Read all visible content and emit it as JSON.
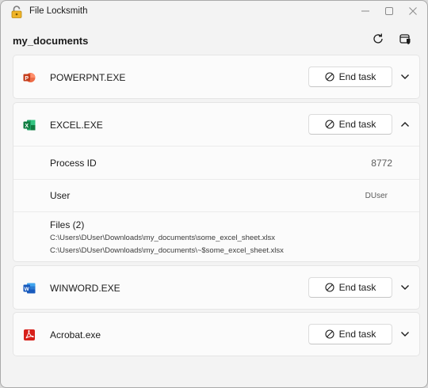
{
  "window": {
    "title": "File Locksmith",
    "controls": {
      "minimize": "minimize",
      "maximize": "maximize",
      "close": "close"
    }
  },
  "header": {
    "folder": "my_documents",
    "refresh_icon": "refresh-icon",
    "admin_icon": "run-as-admin-icon"
  },
  "processes": [
    {
      "name": "POWERPNT.EXE",
      "icon": "powerpoint-icon",
      "end_task_label": "End task",
      "expanded": false,
      "icon_color": "#c43e1c"
    },
    {
      "name": "EXCEL.EXE",
      "icon": "excel-icon",
      "end_task_label": "End task",
      "expanded": true,
      "icon_color": "#107c41",
      "details": {
        "pid_label": "Process ID",
        "pid_value": "8772",
        "user_label": "User",
        "user_value": "DUser",
        "files_label": "Files (2)",
        "files": [
          "C:\\Users\\DUser\\Downloads\\my_documents\\some_excel_sheet.xlsx",
          "C:\\Users\\DUser\\Downloads\\my_documents\\~$some_excel_sheet.xlsx"
        ]
      }
    },
    {
      "name": "WINWORD.EXE",
      "icon": "word-icon",
      "end_task_label": "End task",
      "expanded": false,
      "icon_color": "#185abd"
    },
    {
      "name": "Acrobat.exe",
      "icon": "acrobat-icon",
      "end_task_label": "End task",
      "expanded": false,
      "icon_color": "#d7201a"
    }
  ]
}
